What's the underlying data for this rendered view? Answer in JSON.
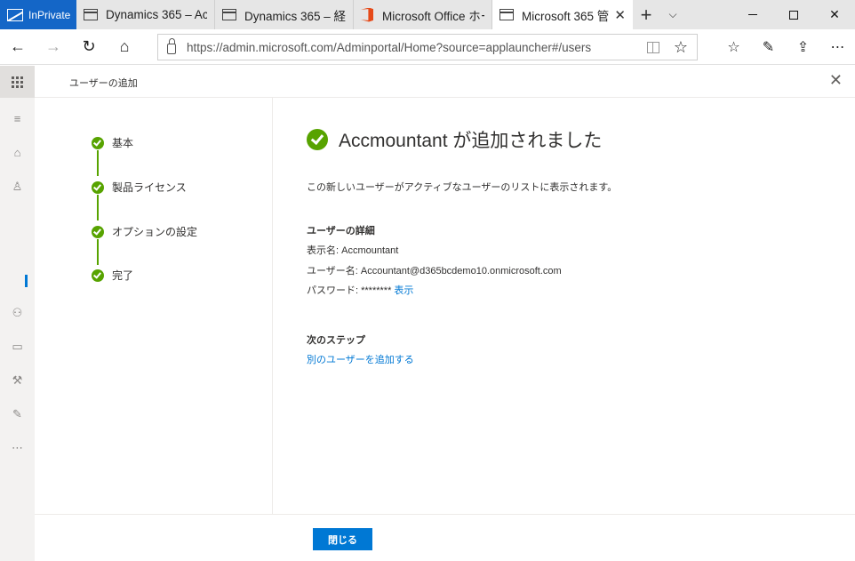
{
  "browser": {
    "inprivate_label": "InPrivate",
    "tabs": [
      {
        "label": "Dynamics 365 – Acc",
        "icon": "page-icon"
      },
      {
        "label": "Dynamics 365 – 経理",
        "icon": "page-icon"
      },
      {
        "label": "Microsoft Office ホー",
        "icon": "office-icon"
      },
      {
        "label": "Microsoft 365 管",
        "icon": "page-icon",
        "close": "✕"
      }
    ],
    "new_tab": "+",
    "url": "https://admin.microsoft.com/Adminportal/Home?source=applauncher#/users"
  },
  "panel": {
    "title": "ユーザーの追加",
    "steps": [
      {
        "label": "基本"
      },
      {
        "label": "製品ライセンス"
      },
      {
        "label": "オプションの設定"
      },
      {
        "label": "完了"
      }
    ],
    "success_title": "Accmountant が追加されました",
    "description": "この新しいユーザーがアクティブなユーザーのリストに表示されます。",
    "details": {
      "heading": "ユーザーの詳細",
      "display_name": "表示名: Accmountant",
      "user_name": "ユーザー名: Accountant@d365bcdemo10.onmicrosoft.com",
      "password_label": "パスワード: ********",
      "show_link": "表示"
    },
    "next_steps": {
      "heading": "次のステップ",
      "add_another_link": "別のユーザーを追加する"
    },
    "close_button": "閉じる"
  },
  "colors": {
    "accent": "#0078d4",
    "success": "#57a300",
    "inprivate": "#1466c7"
  }
}
